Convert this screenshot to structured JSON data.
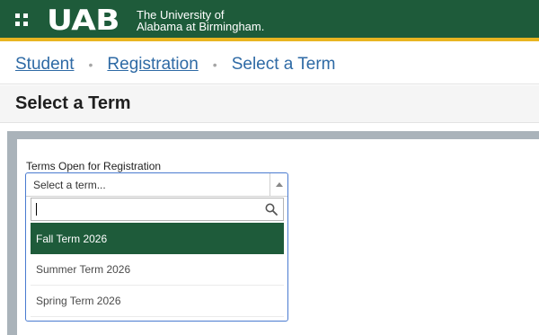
{
  "header": {
    "logo_mark": "UAB",
    "logo_line1": "The University of",
    "logo_line2": "Alabama at Birmingham."
  },
  "breadcrumb": {
    "items": [
      {
        "label": "Student"
      },
      {
        "label": "Registration"
      }
    ],
    "separator": "•",
    "current": "Select a Term"
  },
  "page": {
    "title": "Select a Term"
  },
  "form": {
    "field_label": "Terms Open for Registration",
    "select_placeholder": "Select a term...",
    "search_value": "",
    "options": [
      {
        "label": "Fall Term 2026",
        "selected": true
      },
      {
        "label": "Summer Term 2026",
        "selected": false
      },
      {
        "label": "Spring Term 2026",
        "selected": false
      }
    ]
  },
  "colors": {
    "brand_green": "#1e5b3a",
    "brand_gold": "#e8b521",
    "link_blue": "#2e6aa5",
    "focus_blue": "#4a7bd0"
  },
  "icons": {
    "menu": "app-grid-icon",
    "dropdown": "caret-up-icon",
    "search": "search-icon"
  }
}
